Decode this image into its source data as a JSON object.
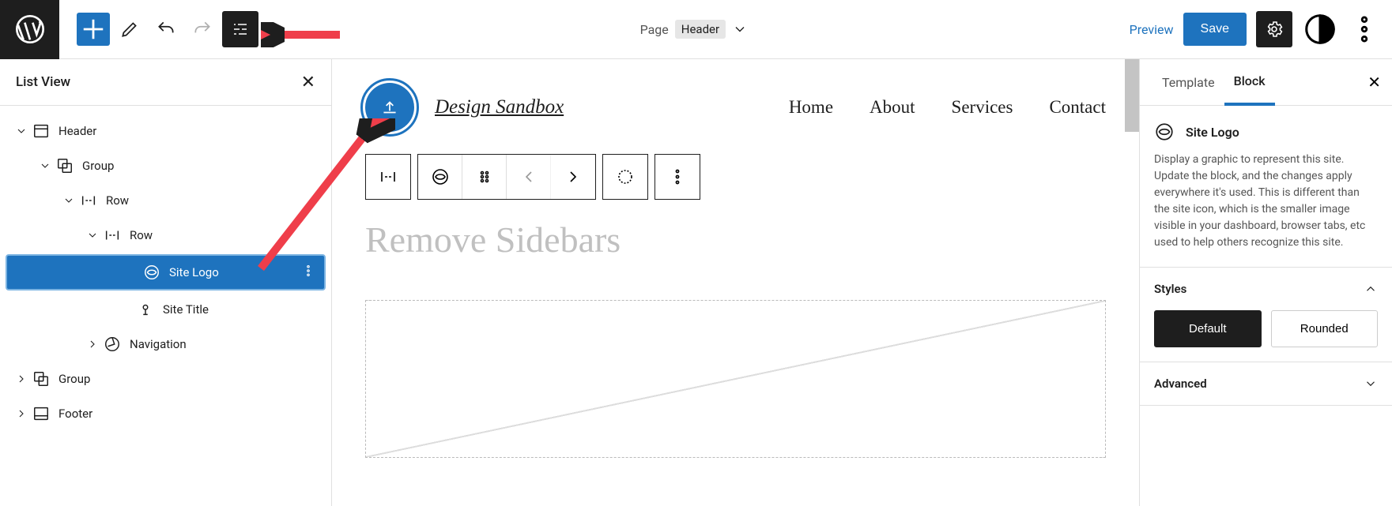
{
  "topbar": {
    "page_label": "Page",
    "template_name": "Header",
    "preview": "Preview",
    "save": "Save"
  },
  "listview": {
    "title": "List View",
    "items": [
      {
        "label": "Header",
        "icon": "header"
      },
      {
        "label": "Group",
        "icon": "group"
      },
      {
        "label": "Row",
        "icon": "row"
      },
      {
        "label": "Row",
        "icon": "row"
      },
      {
        "label": "Site Logo",
        "icon": "site-logo"
      },
      {
        "label": "Site Title",
        "icon": "site-title"
      },
      {
        "label": "Navigation",
        "icon": "navigation"
      },
      {
        "label": "Group",
        "icon": "group"
      },
      {
        "label": "Footer",
        "icon": "footer"
      }
    ]
  },
  "canvas": {
    "site_title": "Design Sandbox",
    "nav": [
      "Home",
      "About",
      "Services",
      "Contact"
    ],
    "page_heading": "Remove Sidebars"
  },
  "sidebar": {
    "tabs": {
      "template": "Template",
      "block": "Block"
    },
    "block_title": "Site Logo",
    "block_desc": "Display a graphic to represent this site. Update the block, and the changes apply everywhere it's used. This is different than the site icon, which is the smaller image visible in your dashboard, browser tabs, etc used to help others recognize this site.",
    "styles": {
      "title": "Styles",
      "default": "Default",
      "rounded": "Rounded"
    },
    "advanced": "Advanced"
  }
}
